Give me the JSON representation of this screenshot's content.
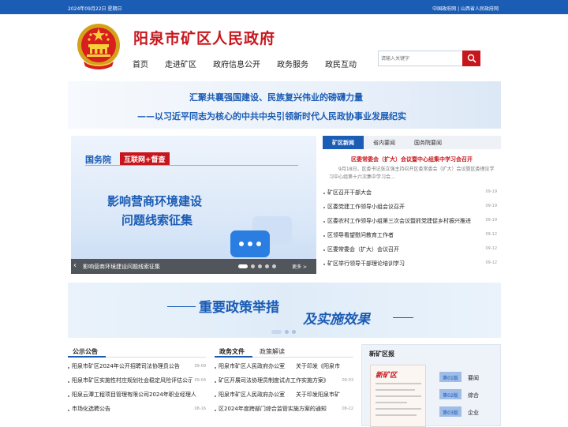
{
  "topbar": {
    "date": "2024年09月22日 星期日",
    "links": "中国政府网 | 山西省人民政府网"
  },
  "header": {
    "title": "阳泉市矿区人民政府",
    "search_placeholder": "请输入关键字"
  },
  "nav": [
    "首页",
    "走进矿区",
    "政府信息公开",
    "政务服务",
    "政民互动"
  ],
  "slogan": {
    "line1": "汇聚共襄强国建设、民族复兴伟业的磅礴力量",
    "line2": "——以习近平同志为核心的中共中央引领新时代人民政协事业发展纪实"
  },
  "banner": {
    "org": "国务院",
    "tag": "互联网+督查",
    "headline1": "影响营商环境建设",
    "headline2": "问题线索征集",
    "caption": "影响营商环境建设问题线索征集",
    "more": "更多 >"
  },
  "news": {
    "tabs": [
      "矿区新闻",
      "省内要闻",
      "国务院要闻"
    ],
    "headline": "区委常委会（扩大）会议暨中心组集中学习会召开",
    "summary": "9月18日，区委书记张立强主持召开区委常委会（扩大）会议暨区委理论学习中心组第十六次集中学习会...",
    "items": [
      {
        "title": "矿区召开干部大会",
        "date": "09-19"
      },
      {
        "title": "区委党建工作领导小组会议召开",
        "date": "09-19"
      },
      {
        "title": "区委农村工作领导小组第三次会议暨抓党建促乡村振兴推进",
        "date": "09-19"
      },
      {
        "title": "区领导看望慰问教育工作者",
        "date": "09-12"
      },
      {
        "title": "区委常委会（扩大）会议召开",
        "date": "09-12"
      },
      {
        "title": "矿区举行领导干部理论培训学习",
        "date": "09-12"
      }
    ]
  },
  "policy": {
    "line1": "重要政策举措",
    "line2": "及实施效果"
  },
  "notices": {
    "title": "公示公告",
    "items": [
      {
        "title": "阳泉市矿区2024年公开招聘司法协理员公告",
        "date": "09-09"
      },
      {
        "title": "阳泉市矿区实施性村庄规划社会稳定风险评估公示",
        "date": "09-04"
      },
      {
        "title": "阳泉云潭工程项目管理有限公司2024年职业经理人",
        "date": ""
      },
      {
        "title": "市场化选聘公告",
        "date": "08-16"
      }
    ]
  },
  "gov_docs": {
    "title": "政务文件",
    "tab2": "政策解读",
    "items": [
      {
        "title": "阳泉市矿区人民政府办公室　　关于印发《阳泉市",
        "date": ""
      },
      {
        "title": "矿区开展司法协理员制度试点工作实施方案》",
        "date": "09-03"
      },
      {
        "title": "阳泉市矿区人民政府办公室　　关于印发阳泉市矿",
        "date": ""
      },
      {
        "title": "区2024年度跨部门综合监管实施方案的通知",
        "date": "08-22"
      }
    ]
  },
  "xkb": {
    "title": "新矿区报",
    "paper_name": "新矿区",
    "editions": [
      {
        "edition": "第01版",
        "label": "要闻"
      },
      {
        "edition": "第02版",
        "label": "综合"
      },
      {
        "edition": "第03版",
        "label": "企业"
      }
    ]
  },
  "colors": {
    "brand_blue": "#1b5cb5",
    "brand_red": "#c8161d"
  }
}
